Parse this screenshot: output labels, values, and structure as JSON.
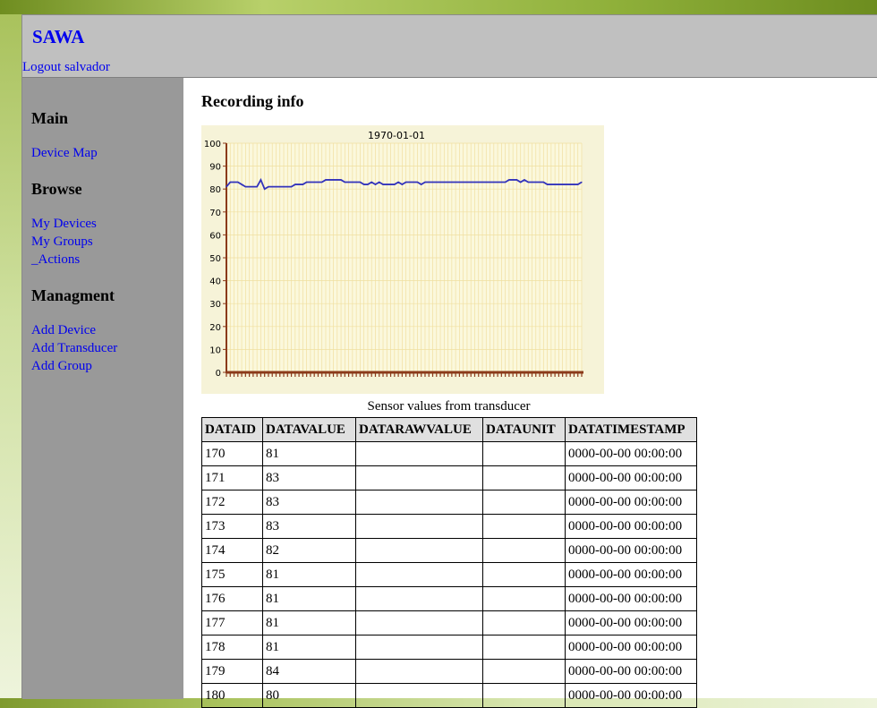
{
  "site": {
    "title": "SAWA",
    "logout_label": "Logout salvador"
  },
  "sidebar": {
    "sections": [
      {
        "heading": "Main",
        "links": [
          "Device Map"
        ]
      },
      {
        "heading": "Browse",
        "links": [
          "My Devices",
          "My Groups",
          "_Actions"
        ]
      },
      {
        "heading": "Managment",
        "links": [
          "Add Device",
          "Add Transducer",
          "Add Group"
        ]
      }
    ]
  },
  "main": {
    "title": "Recording info",
    "caption": "Sensor values from transducer"
  },
  "colors": {
    "chart_bg": "#f6f3d8",
    "plot_bg": "#fbf8dc",
    "grid": "#f0dfa0",
    "axis": "#8b3a1a",
    "line": "#3333bb"
  },
  "chart_data": {
    "type": "line",
    "title": "1970-01-01",
    "ylim": [
      0,
      100
    ],
    "yticks": [
      "0",
      "10",
      "20",
      "30",
      "40",
      "50",
      "60",
      "70",
      "80",
      "90",
      "100"
    ],
    "grid": true,
    "series": [
      {
        "values": [
          81,
          83,
          83,
          83,
          82,
          81,
          81,
          81,
          81,
          84,
          80,
          81,
          81,
          81,
          81,
          81,
          81,
          81,
          82,
          82,
          82,
          83,
          83,
          83,
          83,
          83,
          84,
          84,
          84,
          84,
          84,
          83,
          83,
          83,
          83,
          83,
          82,
          82,
          83,
          82,
          83,
          82,
          82,
          82,
          82,
          83,
          82,
          83,
          83,
          83,
          83,
          82,
          83,
          83,
          83,
          83,
          83,
          83,
          83,
          83,
          83,
          83,
          83,
          83,
          83,
          83,
          83,
          83,
          83,
          83,
          83,
          83,
          83,
          83,
          84,
          84,
          84,
          83,
          84,
          83,
          83,
          83,
          83,
          83,
          82,
          82,
          82,
          82,
          82,
          82,
          82,
          82,
          82,
          83
        ]
      }
    ]
  },
  "table": {
    "headers": [
      "DATAID",
      "DATAVALUE",
      "DATARAWVALUE",
      "DATAUNIT",
      "DATATIMESTAMP"
    ],
    "rows": [
      [
        "170",
        "81",
        "",
        "",
        "0000-00-00 00:00:00"
      ],
      [
        "171",
        "83",
        "",
        "",
        "0000-00-00 00:00:00"
      ],
      [
        "172",
        "83",
        "",
        "",
        "0000-00-00 00:00:00"
      ],
      [
        "173",
        "83",
        "",
        "",
        "0000-00-00 00:00:00"
      ],
      [
        "174",
        "82",
        "",
        "",
        "0000-00-00 00:00:00"
      ],
      [
        "175",
        "81",
        "",
        "",
        "0000-00-00 00:00:00"
      ],
      [
        "176",
        "81",
        "",
        "",
        "0000-00-00 00:00:00"
      ],
      [
        "177",
        "81",
        "",
        "",
        "0000-00-00 00:00:00"
      ],
      [
        "178",
        "81",
        "",
        "",
        "0000-00-00 00:00:00"
      ],
      [
        "179",
        "84",
        "",
        "",
        "0000-00-00 00:00:00"
      ],
      [
        "180",
        "80",
        "",
        "",
        "0000-00-00 00:00:00"
      ]
    ]
  }
}
